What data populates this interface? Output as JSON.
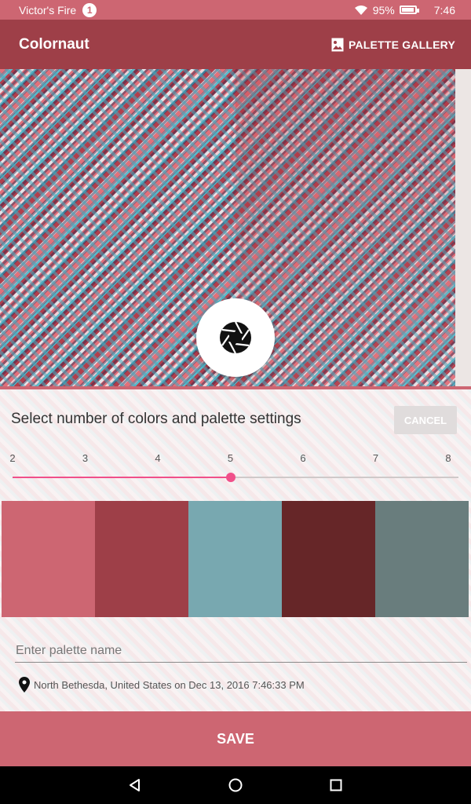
{
  "status_bar": {
    "carrier": "Victor's Fire",
    "notification_count": "1",
    "battery": "95%",
    "time": "7:46"
  },
  "app_bar": {
    "title": "Colornaut",
    "gallery_label": "PALETTE GALLERY"
  },
  "panel": {
    "heading": "Select number of colors and palette settings",
    "cancel_label": "CANCEL",
    "slider": {
      "ticks": [
        "2",
        "3",
        "4",
        "5",
        "6",
        "7",
        "8"
      ],
      "min": 2,
      "max": 8,
      "value": 5,
      "accent": "#f0508a"
    },
    "swatches": [
      "#cd6672",
      "#9e3f48",
      "#78a8b0",
      "#662628",
      "#697d7d"
    ],
    "name_placeholder": "Enter palette name",
    "location_text": "North Bethesda, United States on Dec 13, 2016 7:46:33 PM"
  },
  "save_label": "SAVE",
  "icons": {
    "shutter": "camera-aperture-icon",
    "gallery": "image-icon",
    "location": "map-pin-icon",
    "wifi": "wifi-icon",
    "battery": "battery-icon"
  },
  "colors": {
    "primary": "#cd6672",
    "primary_dark": "#9e3f48"
  }
}
